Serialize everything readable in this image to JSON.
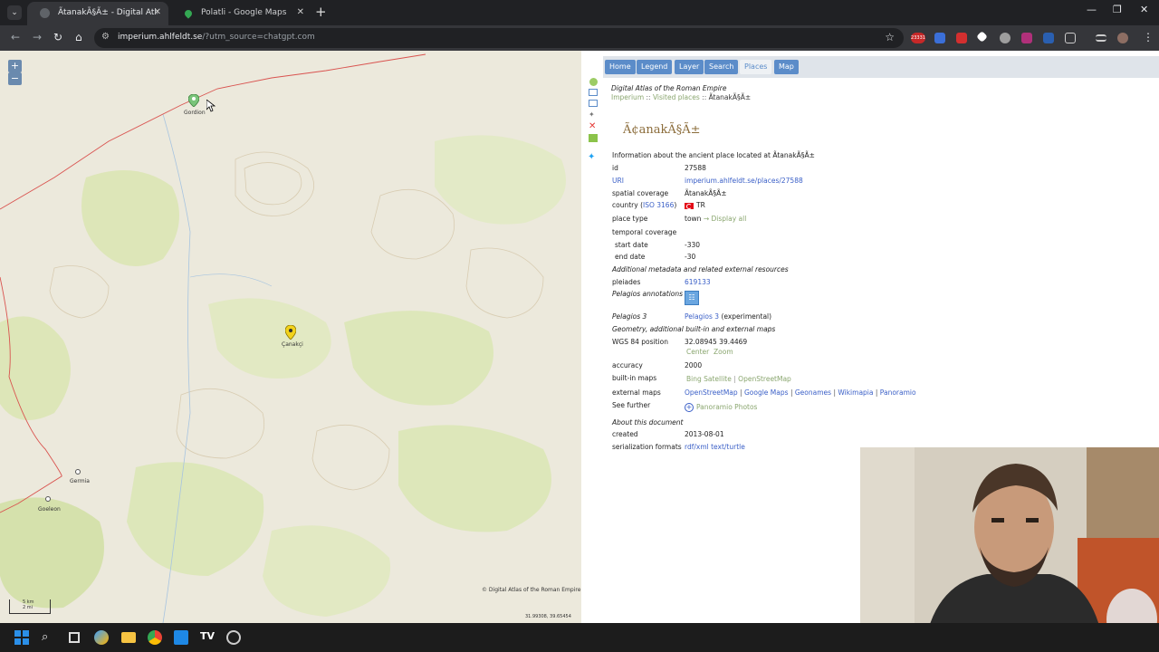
{
  "browser": {
    "tabs": [
      {
        "title": "ÃtanakÃ§Ã± - Digital Atlas of the Roman Empire",
        "active": true
      },
      {
        "title": "Polatli - Google Maps",
        "active": false
      }
    ],
    "url": "imperium.ahlfeldt.se",
    "url_query": "/?utm_source=chatgpt.com",
    "notification_badge": "23331"
  },
  "map": {
    "zoom_in": "+",
    "zoom_out": "−",
    "places": [
      {
        "name": "Gordion"
      },
      {
        "name": "Çanakçi"
      },
      {
        "name": "Germia"
      },
      {
        "name": "Gordion2",
        "label": "Goeleon"
      }
    ],
    "attribution": "© Digital Atlas of the Roman Empire",
    "coordinates": "31.99308, 39.65454",
    "scale_km": "5 km",
    "scale_mi": "2 mi"
  },
  "nav": {
    "items": [
      "Home",
      "Legend",
      "Layer",
      "Search",
      "Places",
      "Map"
    ],
    "selected": "Places"
  },
  "breadcrumb": {
    "site": "Digital Atlas of the Roman Empire",
    "root": "Imperium",
    "section": "Visited places",
    "current": "ÃtanakÃ§Ã±",
    "separator": "::"
  },
  "place": {
    "title": "Ã¢anakÃ§Ã±",
    "intro": "Information about the ancient place located at ÃtanakÃ§Ã±",
    "id_label": "id",
    "id": "27588",
    "uri_label": "URI",
    "uri": "imperium.ahlfeldt.se/places/27588",
    "spatial_label": "spatial coverage",
    "spatial": "ÃtanakÃ§Ã±",
    "country_label": "country",
    "country_iso": "ISO 3166",
    "country": "TR",
    "place_type_label": "place type",
    "place_type": "town",
    "display_all": "→ Display all",
    "temporal_label": "temporal coverage",
    "start_label": "start date",
    "start": "-330",
    "end_label": "end date",
    "end": "-30",
    "additional": "Additional metadata and related external resources",
    "pleiades_label": "pleiades",
    "pleiades": "619133",
    "pelagios_ann_label": "Pelagios annotations",
    "pelagios3_label": "Pelagios 3",
    "pelagios3_link": "Pelagios 3",
    "pelagios3_note": "(experimental)",
    "geometry": "Geometry, additional built-in and external maps",
    "wgs_label": "WGS 84 position",
    "wgs": "32.08945 39.4469",
    "center": "Center",
    "zoom": "Zoom",
    "accuracy_label": "accuracy",
    "accuracy": "2000",
    "builtin_label": "built-in maps",
    "builtin": [
      "Bing Satellite",
      "OpenStreetMap"
    ],
    "external_label": "external maps",
    "external": [
      "OpenStreetMap",
      "Google Maps",
      "Geonames",
      "Wikimapia",
      "Panoramio"
    ],
    "see_label": "See further",
    "see": "Panoramio Photos",
    "about": "About this document",
    "created_label": "created",
    "created": "2013-08-01",
    "serial_label": "serialization formats",
    "serial": "rdf/xml text/turtle"
  },
  "colors": {
    "nav_blue": "#5b8cc9",
    "link_blue": "#3a5fc7",
    "link_green": "#8aa66f",
    "title_brown": "#8b6c3a",
    "road_red": "#d9534f"
  }
}
